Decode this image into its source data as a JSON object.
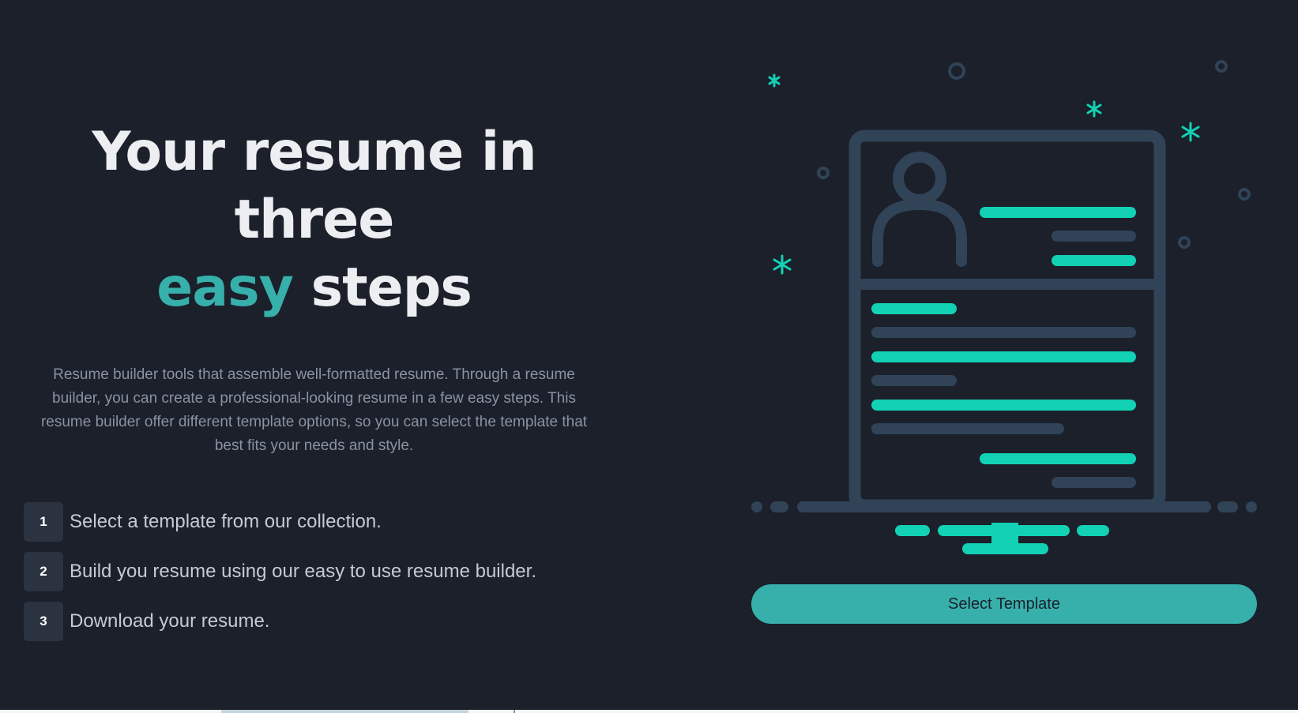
{
  "hero": {
    "title_line1": "Your resume in three",
    "title_accent": "easy",
    "title_rest": "steps",
    "description": "Resume builder tools that assemble well-formatted resume. Through a resume builder, you can create a professional-looking resume in a few easy steps. This resume builder offer different template options, so you can select the template that best fits your needs and style."
  },
  "steps": [
    {
      "number": "1",
      "text": "Select a template from our collection."
    },
    {
      "number": "2",
      "text": "Build you resume using our easy to use resume builder."
    },
    {
      "number": "3",
      "text": "Download your resume."
    }
  ],
  "cta": {
    "label": "Select Template"
  },
  "illustration": {
    "icon": "resume-document-icon",
    "decorations": [
      "sparkle-icon",
      "circle-icon"
    ]
  },
  "colors": {
    "background": "#1b202b",
    "accent": "#37b0ab",
    "illustration_accent": "#12d1b4",
    "illustration_line": "#304357",
    "heading": "#eceef2",
    "body_text": "#8a93a3",
    "step_box": "#2c3340"
  }
}
